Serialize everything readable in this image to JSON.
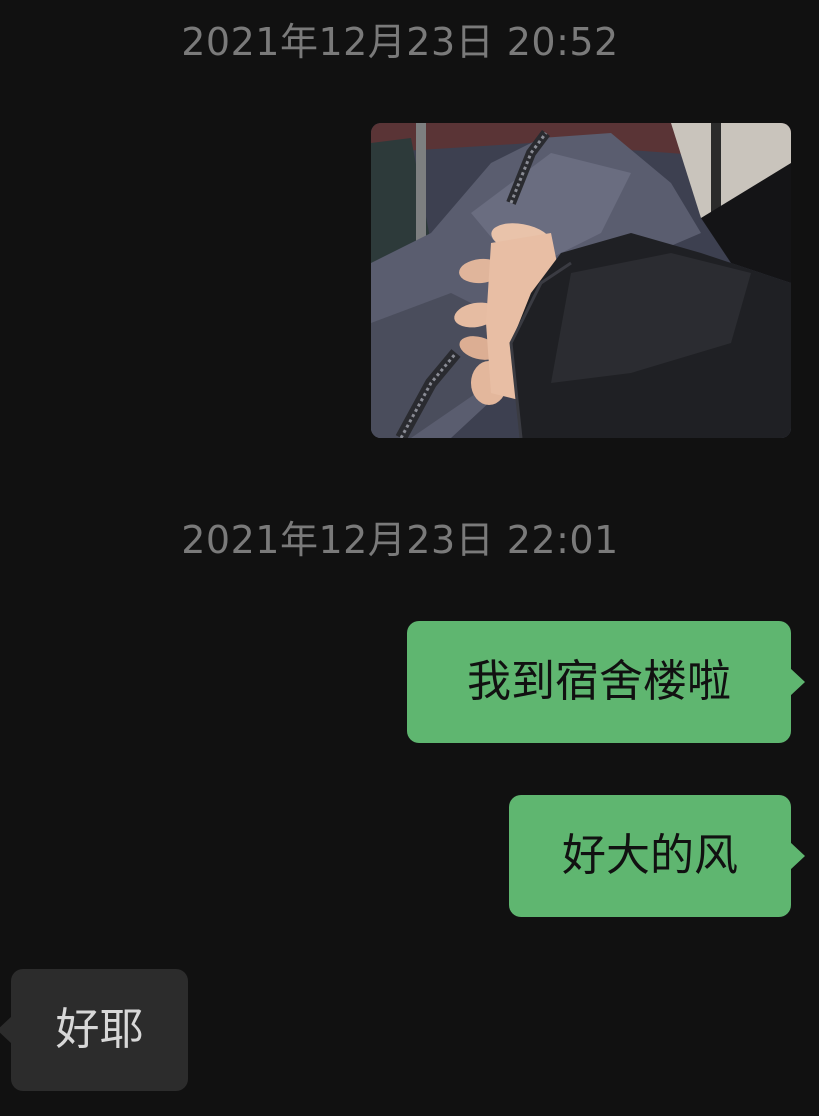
{
  "chat": {
    "timestamps": [
      "2021年12月23日 20:52",
      "2021年12月23日 22:01"
    ],
    "messages": [
      {
        "direction": "outgoing",
        "type": "image",
        "image_subject": "hands-holding-photo"
      },
      {
        "direction": "outgoing",
        "type": "text",
        "text": "我到宿舍楼啦"
      },
      {
        "direction": "outgoing",
        "type": "text",
        "text": "好大的风"
      },
      {
        "direction": "incoming",
        "type": "text",
        "text": "好耶"
      }
    ]
  },
  "colors": {
    "background": "#111111",
    "outgoing_bubble": "#5fb670",
    "incoming_bubble": "#2c2c2c",
    "timestamp_text": "#7a7a7a"
  }
}
